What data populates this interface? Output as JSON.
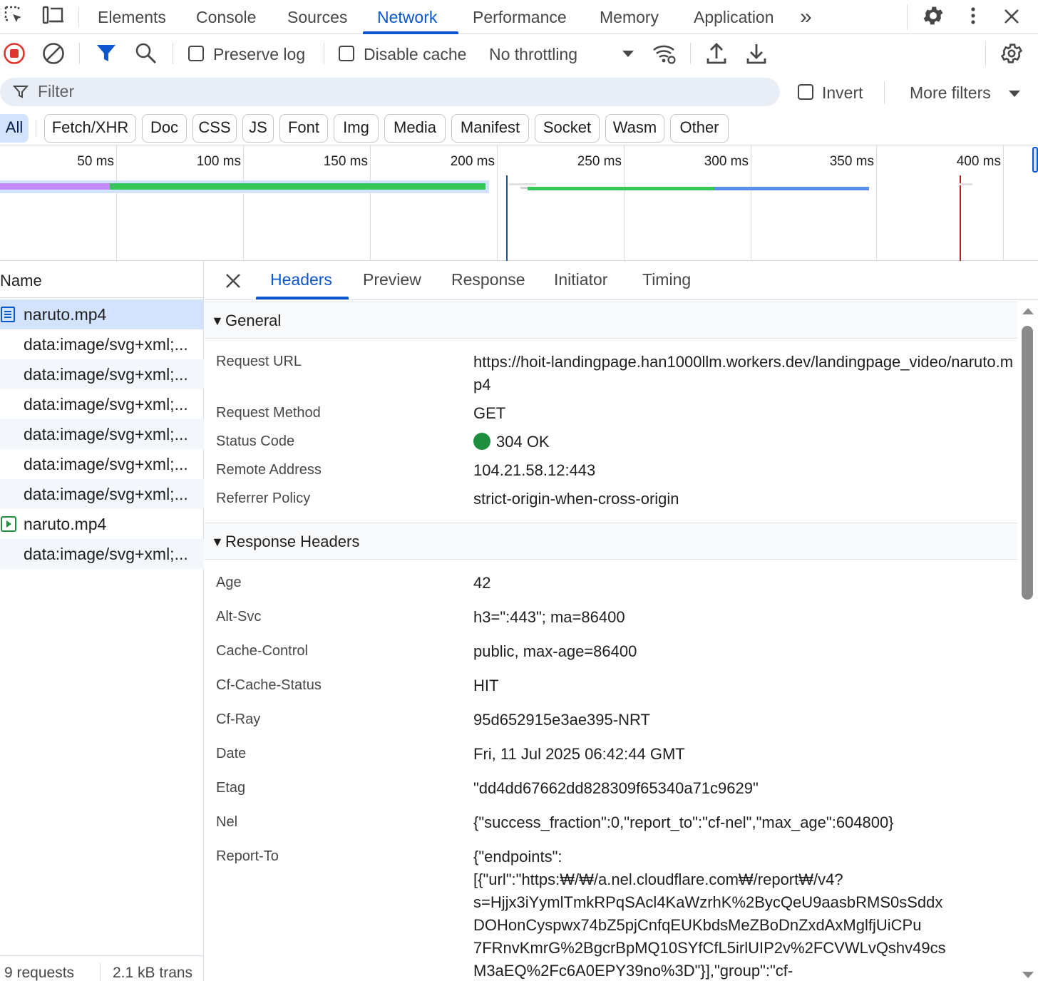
{
  "topbar": {
    "tabs": [
      "Elements",
      "Console",
      "Sources",
      "Network",
      "Performance",
      "Memory",
      "Application"
    ],
    "active_tab": "Network",
    "more_tabs_glyph": "»"
  },
  "toolbar": {
    "preserve_log_label": "Preserve log",
    "preserve_log_checked": false,
    "disable_cache_label": "Disable cache",
    "disable_cache_checked": false,
    "throttling_value": "No throttling"
  },
  "filter": {
    "placeholder": "Filter",
    "invert_label": "Invert",
    "more_filters_label": "More filters"
  },
  "type_filters": [
    "All",
    "Fetch/XHR",
    "Doc",
    "CSS",
    "JS",
    "Font",
    "Img",
    "Media",
    "Manifest",
    "Socket",
    "Wasm",
    "Other"
  ],
  "active_type_filter": "All",
  "overview": {
    "ticks": [
      "50 ms",
      "100 ms",
      "150 ms",
      "200 ms",
      "250 ms",
      "300 ms",
      "350 ms",
      "400 ms"
    ]
  },
  "request_list": {
    "column_header": "Name",
    "rows": [
      {
        "name": "naruto.mp4",
        "icon": "document-icon",
        "selected": true
      },
      {
        "name": "data:image/svg+xml;...",
        "icon": "",
        "selected": false
      },
      {
        "name": "data:image/svg+xml;...",
        "icon": "",
        "selected": false
      },
      {
        "name": "data:image/svg+xml;...",
        "icon": "",
        "selected": false
      },
      {
        "name": "data:image/svg+xml;...",
        "icon": "",
        "selected": false
      },
      {
        "name": "data:image/svg+xml;...",
        "icon": "",
        "selected": false
      },
      {
        "name": "data:image/svg+xml;...",
        "icon": "",
        "selected": false
      },
      {
        "name": "naruto.mp4",
        "icon": "media-icon",
        "selected": false
      },
      {
        "name": "data:image/svg+xml;...",
        "icon": "",
        "selected": false
      }
    ],
    "status": {
      "requests": "9 requests",
      "transferred": "2.1 kB trans"
    }
  },
  "detail": {
    "tabs": [
      "Headers",
      "Preview",
      "Response",
      "Initiator",
      "Timing"
    ],
    "active_tab": "Headers",
    "general": {
      "title": "General",
      "request_url_label": "Request URL",
      "request_url": "https://hoit-landingpage.han1000llm.workers.dev/landingpage_video/naruto.mp4",
      "request_method_label": "Request Method",
      "request_method": "GET",
      "status_code_label": "Status Code",
      "status_code": "304 OK",
      "status_color": "#1e8e3e",
      "remote_address_label": "Remote Address",
      "remote_address": "104.21.58.12:443",
      "referrer_policy_label": "Referrer Policy",
      "referrer_policy": "strict-origin-when-cross-origin"
    },
    "response_headers": {
      "title": "Response Headers",
      "items": [
        {
          "key": "Age",
          "value": "42"
        },
        {
          "key": "Alt-Svc",
          "value": "h3=\":443\"; ma=86400"
        },
        {
          "key": "Cache-Control",
          "value": "public, max-age=86400"
        },
        {
          "key": "Cf-Cache-Status",
          "value": "HIT"
        },
        {
          "key": "Cf-Ray",
          "value": "95d652915e3ae395-NRT"
        },
        {
          "key": "Date",
          "value": "Fri, 11 Jul 2025 06:42:44 GMT"
        },
        {
          "key": "Etag",
          "value": "\"dd4dd67662dd828309f65340a71c9629\""
        },
        {
          "key": "Nel",
          "value": "{\"success_fraction\":0,\"report_to\":\"cf-nel\",\"max_age\":604800}"
        },
        {
          "key": "Report-To",
          "value": "{\"endpoints\":\n[{\"url\":\"https:₩/₩/a.nel.cloudflare.com₩/report₩/v4?\ns=Hjjx3iYymlTmkRPqSAcl4KaWzrhK%2BycQeU9aasbRMS0sSddx\nDOHonCyspwx74bZ5pjCnfqEUKbdsMeZBoDnZxdAxMglfjUiCPu\n7FRnvKmrG%2BgcrBpMQ10SYfCfL5irlUIP2v%2FCVWLvQshv49cs\nM3aEQ%2Fc6A0EPY39no%3D\"}],\"group\":\"cf-"
        }
      ]
    }
  },
  "colors": {
    "accent": "#0b57d0",
    "record_red": "#dc362e",
    "bar_purple": "#c58af9",
    "bar_green": "#34c85a",
    "bar_blue": "#5b8def",
    "marker_blue": "#1a4fa0",
    "marker_red": "#b3261e"
  }
}
